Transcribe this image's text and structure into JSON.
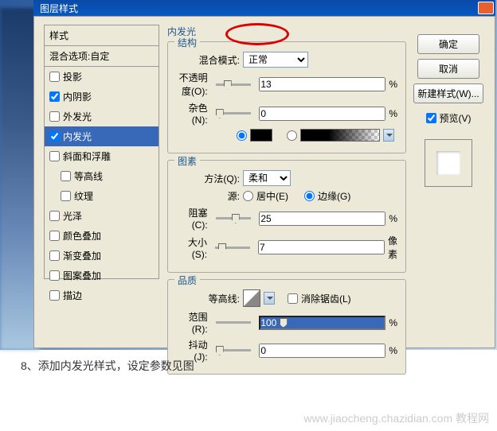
{
  "titlebar": {
    "fragment": "图层样式",
    "close": "X"
  },
  "styles": {
    "header": "样式",
    "blend_default": "混合选项:自定",
    "items": [
      {
        "label": "投影",
        "checked": false,
        "indent": false
      },
      {
        "label": "内阴影",
        "checked": true,
        "indent": false
      },
      {
        "label": "外发光",
        "checked": false,
        "indent": false
      },
      {
        "label": "内发光",
        "checked": true,
        "indent": false,
        "active": true
      },
      {
        "label": "斜面和浮雕",
        "checked": false,
        "indent": false
      },
      {
        "label": "等高线",
        "checked": false,
        "indent": true
      },
      {
        "label": "纹理",
        "checked": false,
        "indent": true
      },
      {
        "label": "光泽",
        "checked": false,
        "indent": false
      },
      {
        "label": "颜色叠加",
        "checked": false,
        "indent": false
      },
      {
        "label": "渐变叠加",
        "checked": false,
        "indent": false
      },
      {
        "label": "图案叠加",
        "checked": false,
        "indent": false
      },
      {
        "label": "描边",
        "checked": false,
        "indent": false
      }
    ]
  },
  "panel_title": "内发光",
  "structure": {
    "title": "结构",
    "blend_mode_label": "混合模式:",
    "blend_mode_value": "正常",
    "opacity_label": "不透明度(O):",
    "opacity_value": "13",
    "opacity_unit": "%",
    "noise_label": "杂色(N):",
    "noise_value": "0",
    "noise_unit": "%",
    "color_black": "#000000"
  },
  "elements": {
    "title": "图素",
    "technique_label": "方法(Q):",
    "technique_value": "柔和",
    "source_label": "源:",
    "center_label": "居中(E)",
    "edge_label": "边缘(G)",
    "choke_label": "阻塞(C):",
    "choke_value": "25",
    "choke_unit": "%",
    "size_label": "大小(S):",
    "size_value": "7",
    "size_unit": "像素"
  },
  "quality": {
    "title": "品质",
    "contour_label": "等高线:",
    "antialias_label": "消除锯齿(L)",
    "range_label": "范围(R):",
    "range_value": "100",
    "range_unit": "%",
    "jitter_label": "抖动(J):",
    "jitter_value": "0",
    "jitter_unit": "%"
  },
  "buttons": {
    "ok": "确定",
    "cancel": "取消",
    "new_style": "新建样式(W)...",
    "preview": "预览(V)"
  },
  "caption": "8、添加内发光样式，设定参数见图",
  "watermark": "www.jiaocheng.chazidian.com 教程网"
}
